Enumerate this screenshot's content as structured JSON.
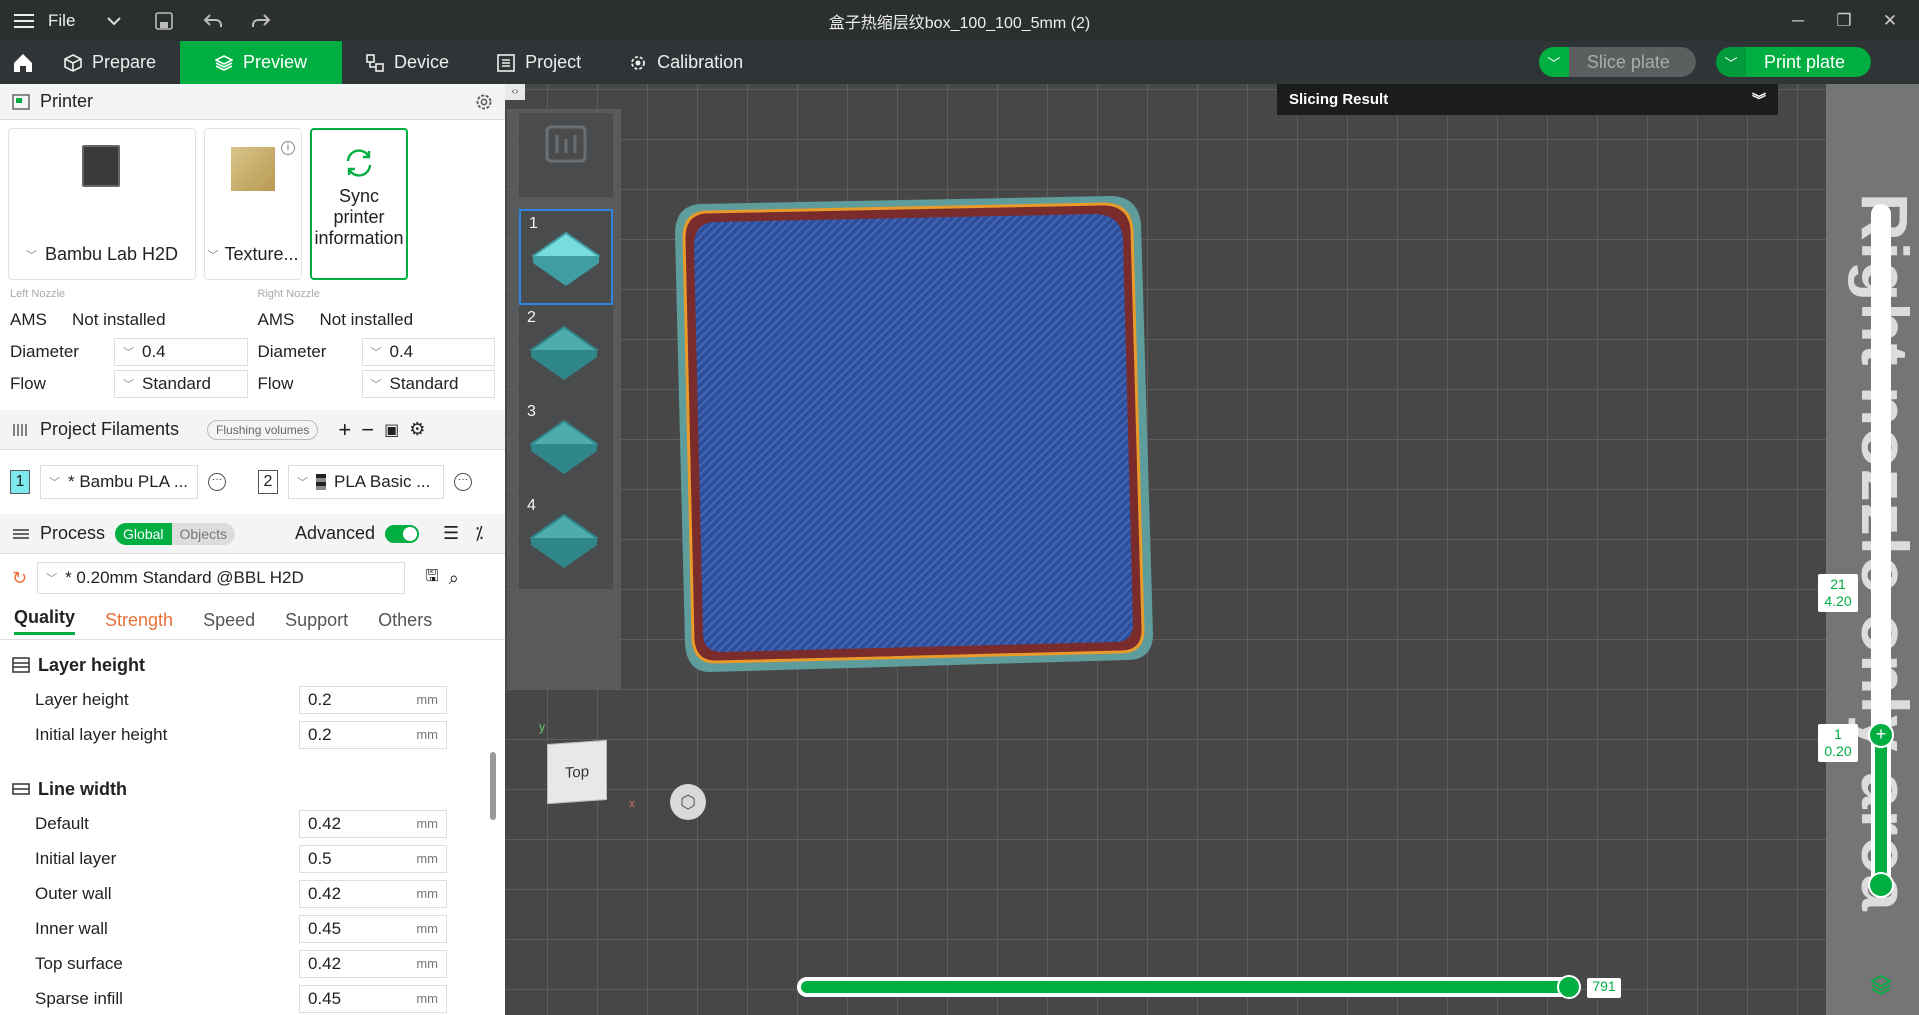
{
  "titlebar": {
    "menu_label": "File",
    "title": "盒子热缩层纹box_100_100_5mm (2)"
  },
  "nav": {
    "tabs": [
      {
        "label": "Prepare"
      },
      {
        "label": "Preview"
      },
      {
        "label": "Device"
      },
      {
        "label": "Project"
      },
      {
        "label": "Calibration"
      }
    ],
    "slice_label": "Slice plate",
    "print_label": "Print plate"
  },
  "printer": {
    "section_title": "Printer",
    "printer_name": "Bambu Lab H2D",
    "plate_name": "Texture...",
    "sync_label_1": "Sync printer",
    "sync_label_2": "information",
    "left": {
      "caption": "Left Nozzle",
      "ams_key": "AMS",
      "ams_value": "Not installed",
      "diameter_key": "Diameter",
      "diameter_value": "0.4",
      "flow_key": "Flow",
      "flow_value": "Standard"
    },
    "right": {
      "caption": "Right Nozzle",
      "ams_key": "AMS",
      "ams_value": "Not installed",
      "diameter_key": "Diameter",
      "diameter_value": "0.4",
      "flow_key": "Flow",
      "flow_value": "Standard"
    }
  },
  "filaments": {
    "section_title": "Project Filaments",
    "flushing_label": "Flushing volumes",
    "items": [
      {
        "index": "1",
        "name": "* Bambu PLA ...",
        "color": "#7de8f0"
      },
      {
        "index": "2",
        "name": "PLA Basic ...",
        "color": "#ffffff"
      }
    ]
  },
  "process": {
    "section_title": "Process",
    "global_label": "Global",
    "objects_label": "Objects",
    "advanced_label": "Advanced",
    "preset": "* 0.20mm Standard @BBL H2D",
    "tabs": [
      "Quality",
      "Strength",
      "Speed",
      "Support",
      "Others"
    ]
  },
  "params": {
    "group1": "Layer height",
    "group2": "Line width",
    "layer": [
      {
        "label": "Layer height",
        "value": "0.2",
        "unit": "mm"
      },
      {
        "label": "Initial layer height",
        "value": "0.2",
        "unit": "mm"
      }
    ],
    "width": [
      {
        "label": "Default",
        "value": "0.42",
        "unit": "mm"
      },
      {
        "label": "Initial layer",
        "value": "0.5",
        "unit": "mm"
      },
      {
        "label": "Outer wall",
        "value": "0.42",
        "unit": "mm"
      },
      {
        "label": "Inner wall",
        "value": "0.45",
        "unit": "mm"
      },
      {
        "label": "Top surface",
        "value": "0.42",
        "unit": "mm"
      },
      {
        "label": "Sparse infill",
        "value": "0.45",
        "unit": "mm"
      }
    ]
  },
  "viewport": {
    "result_title": "Slicing Result",
    "plates": [
      "1",
      "2",
      "3",
      "4"
    ],
    "cube_label": "Top",
    "axis_x": "x",
    "axis_y": "y",
    "hslider_value": "791",
    "layer_top": "21",
    "height_top": "4.20",
    "layer_bottom": "1",
    "height_bottom": "0.20",
    "overlay_text": "Right nozzle only area"
  }
}
